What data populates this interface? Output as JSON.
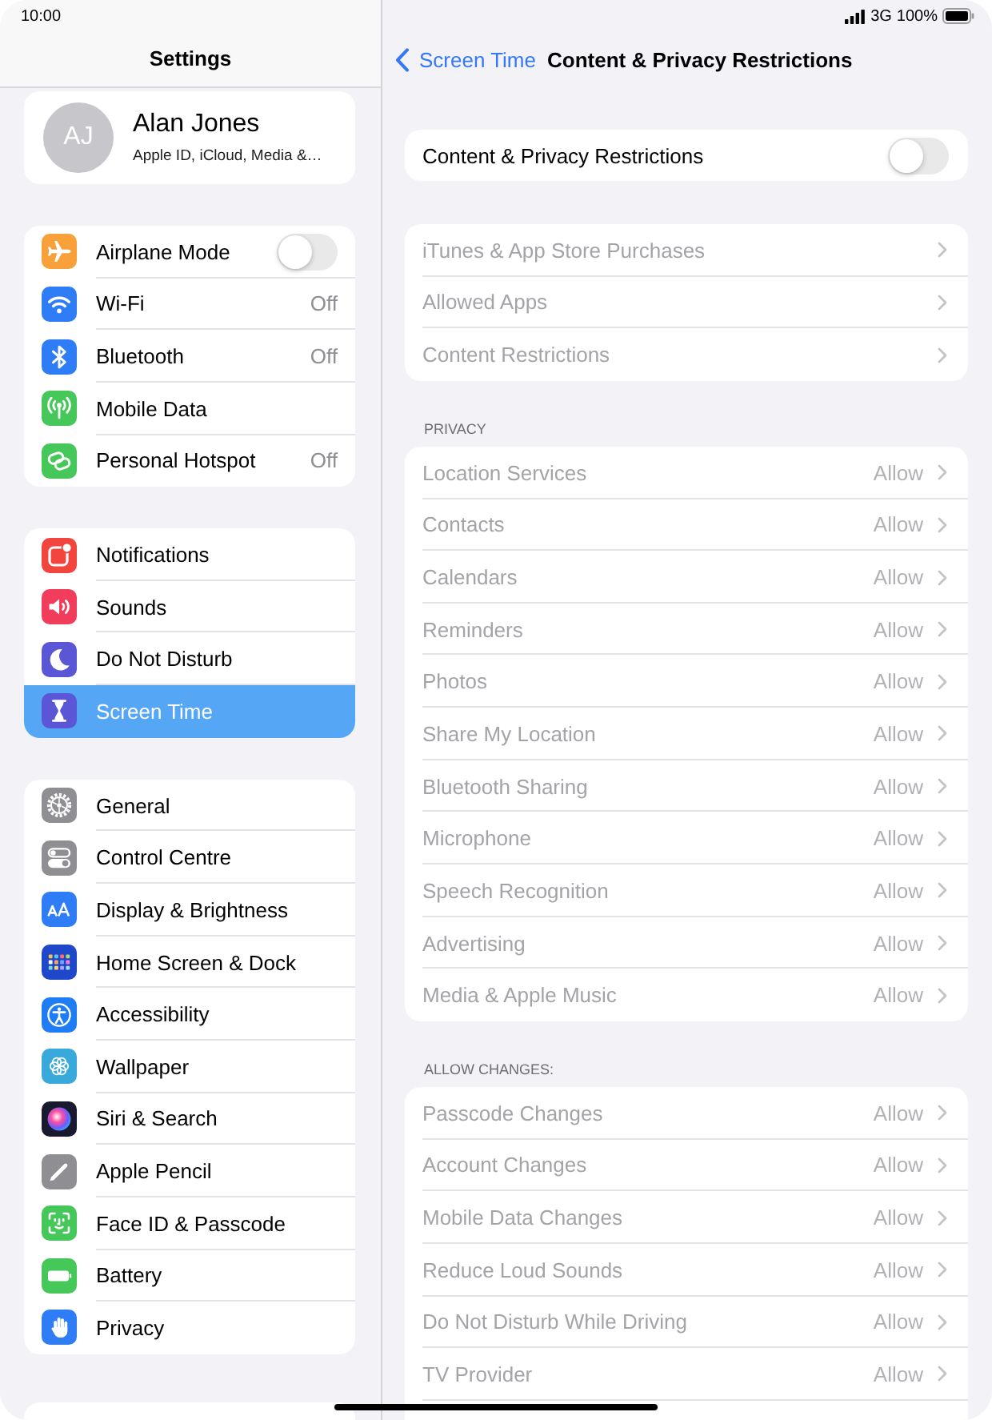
{
  "status_bar": {
    "time": "10:00",
    "network": "3G",
    "battery": "100%"
  },
  "sidebar": {
    "title": "Settings",
    "profile": {
      "initials": "AJ",
      "name": "Alan Jones",
      "subtitle": "Apple ID, iCloud, Media &…"
    },
    "groups": [
      {
        "items": [
          {
            "label": "Airplane Mode",
            "kind": "toggle",
            "on": false,
            "selected": false
          },
          {
            "label": "Wi-Fi",
            "kind": "link",
            "value": "Off",
            "selected": false
          },
          {
            "label": "Bluetooth",
            "kind": "link",
            "value": "Off",
            "selected": false
          },
          {
            "label": "Mobile Data",
            "kind": "link",
            "selected": false
          },
          {
            "label": "Personal Hotspot",
            "kind": "link",
            "value": "Off",
            "selected": false
          }
        ]
      },
      {
        "items": [
          {
            "label": "Notifications",
            "kind": "link",
            "selected": false
          },
          {
            "label": "Sounds",
            "kind": "link",
            "selected": false
          },
          {
            "label": "Do Not Disturb",
            "kind": "link",
            "selected": false
          },
          {
            "label": "Screen Time",
            "kind": "link",
            "selected": true
          }
        ]
      },
      {
        "items": [
          {
            "label": "General",
            "kind": "link",
            "selected": false
          },
          {
            "label": "Control Centre",
            "kind": "link",
            "selected": false
          },
          {
            "label": "Display & Brightness",
            "kind": "link",
            "selected": false
          },
          {
            "label": "Home Screen & Dock",
            "kind": "link",
            "selected": false
          },
          {
            "label": "Accessibility",
            "kind": "link",
            "selected": false
          },
          {
            "label": "Wallpaper",
            "kind": "link",
            "selected": false
          },
          {
            "label": "Siri & Search",
            "kind": "link",
            "selected": false
          },
          {
            "label": "Apple Pencil",
            "kind": "link",
            "selected": false
          },
          {
            "label": "Face ID & Passcode",
            "kind": "link",
            "selected": false
          },
          {
            "label": "Battery",
            "kind": "link",
            "selected": false
          },
          {
            "label": "Privacy",
            "kind": "link",
            "selected": false
          }
        ]
      }
    ]
  },
  "detail": {
    "back": "Screen Time",
    "title": "Content & Privacy Restrictions",
    "master": {
      "label": "Content & Privacy Restrictions",
      "on": false
    },
    "sections": [
      {
        "items": [
          {
            "label": "iTunes & App Store Purchases",
            "disabled": true
          },
          {
            "label": "Allowed Apps",
            "disabled": true
          },
          {
            "label": "Content Restrictions",
            "disabled": true
          }
        ]
      },
      {
        "header": "PRIVACY",
        "items": [
          {
            "label": "Location Services",
            "value": "Allow",
            "disabled": true
          },
          {
            "label": "Contacts",
            "value": "Allow",
            "disabled": true
          },
          {
            "label": "Calendars",
            "value": "Allow",
            "disabled": true
          },
          {
            "label": "Reminders",
            "value": "Allow",
            "disabled": true
          },
          {
            "label": "Photos",
            "value": "Allow",
            "disabled": true
          },
          {
            "label": "Share My Location",
            "value": "Allow",
            "disabled": true
          },
          {
            "label": "Bluetooth Sharing",
            "value": "Allow",
            "disabled": true
          },
          {
            "label": "Microphone",
            "value": "Allow",
            "disabled": true
          },
          {
            "label": "Speech Recognition",
            "value": "Allow",
            "disabled": true
          },
          {
            "label": "Advertising",
            "value": "Allow",
            "disabled": true
          },
          {
            "label": "Media & Apple Music",
            "value": "Allow",
            "disabled": true
          }
        ]
      },
      {
        "header": "ALLOW CHANGES:",
        "items": [
          {
            "label": "Passcode Changes",
            "value": "Allow",
            "disabled": true
          },
          {
            "label": "Account Changes",
            "value": "Allow",
            "disabled": true
          },
          {
            "label": "Mobile Data Changes",
            "value": "Allow",
            "disabled": true
          },
          {
            "label": "Reduce Loud Sounds",
            "value": "Allow",
            "disabled": true
          },
          {
            "label": "Do Not Disturb While Driving",
            "value": "Allow",
            "disabled": true
          },
          {
            "label": "TV Provider",
            "value": "Allow",
            "disabled": true
          }
        ]
      }
    ]
  }
}
